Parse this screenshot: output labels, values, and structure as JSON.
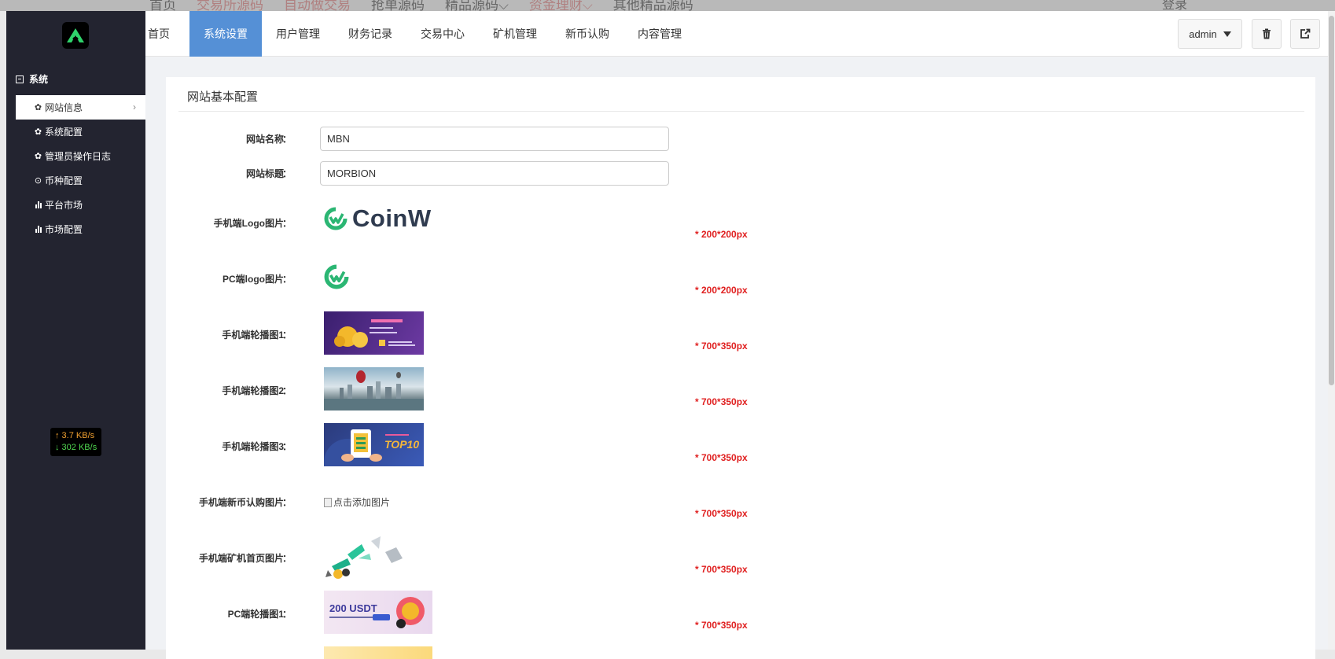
{
  "backdrop": {
    "nav": [
      "首页",
      "交易所源码",
      "自动做交易",
      "抢单源码",
      "精品源码⌵",
      "资金理财⌵",
      "其他精品源码"
    ],
    "login": "登录"
  },
  "sidebar": {
    "section_title": "系统",
    "items": [
      {
        "label": "网站信息",
        "icon": "gear-icon"
      },
      {
        "label": "系统配置",
        "icon": "gear-icon"
      },
      {
        "label": "管理员操作日志",
        "icon": "gear-icon"
      },
      {
        "label": "币种配置",
        "icon": "circle-dot-icon"
      },
      {
        "label": "平台市场",
        "icon": "bar-chart-icon"
      },
      {
        "label": "市场配置",
        "icon": "bar-chart-icon"
      }
    ],
    "speed_up": "↑ 3.7 KB/s",
    "speed_down": "↓ 302 KB/s"
  },
  "topbar": {
    "tabs": [
      "首页",
      "系统设置",
      "用户管理",
      "财务记录",
      "交易中心",
      "矿机管理",
      "新币认购",
      "内容管理"
    ],
    "active_tab": "系统设置",
    "user": "admin"
  },
  "panel": {
    "title": "网站基本配置",
    "fields": [
      {
        "label": "网站名称",
        "value": "MBN"
      },
      {
        "label": "网站标题",
        "value": "MORBION"
      }
    ],
    "images": [
      {
        "label": "手机端Logo图片",
        "note": "* 200*200px",
        "logo_text": "CoinW"
      },
      {
        "label": "PC端logo图片",
        "note": "* 200*200px"
      },
      {
        "label": "手机端轮播图1",
        "note": "* 700*350px"
      },
      {
        "label": "手机端轮播图2",
        "note": "* 700*350px"
      },
      {
        "label": "手机端轮播图3",
        "note": "* 700*350px",
        "banner_text": "TOP10"
      },
      {
        "label": "手机端新币认购图片",
        "note": "* 700*350px",
        "alt": "点击添加图片"
      },
      {
        "label": "手机端矿机首页图片",
        "note": "* 700*350px"
      },
      {
        "label": "PC端轮播图1",
        "note": "* 700*350px",
        "banner_text": "200 USDT"
      }
    ]
  },
  "colors": {
    "sidebar": "#232430",
    "active_tab": "#5590d6",
    "note_red": "#e02020",
    "coinw_green": "#2bb673"
  }
}
